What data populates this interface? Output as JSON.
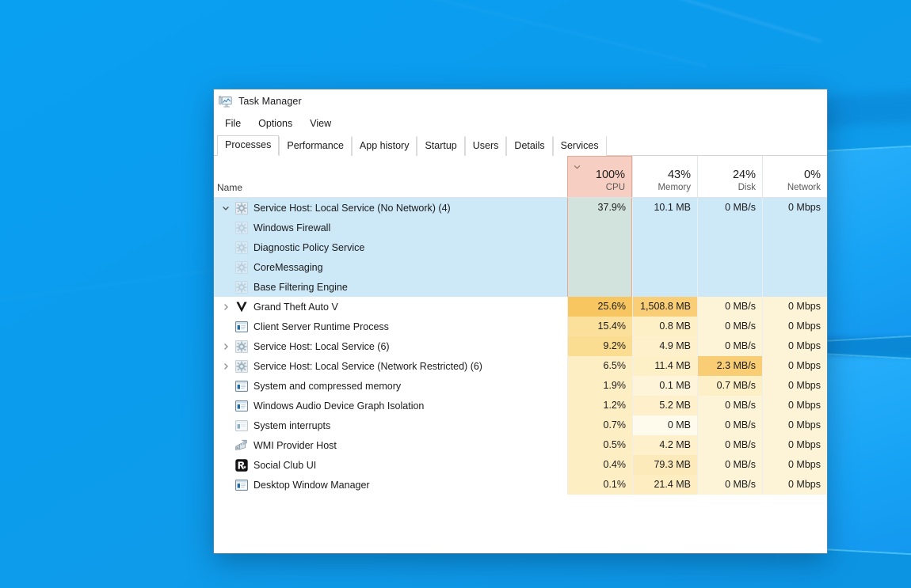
{
  "window": {
    "title": "Task Manager",
    "icon": "task-manager-icon"
  },
  "menu": {
    "items": [
      {
        "label": "File"
      },
      {
        "label": "Options"
      },
      {
        "label": "View"
      }
    ]
  },
  "tabs": {
    "active": "Processes",
    "items": [
      {
        "label": "Processes"
      },
      {
        "label": "Performance"
      },
      {
        "label": "App history"
      },
      {
        "label": "Startup"
      },
      {
        "label": "Users"
      },
      {
        "label": "Details"
      },
      {
        "label": "Services"
      }
    ]
  },
  "columns": {
    "name": {
      "label": "Name"
    },
    "cpu": {
      "value": "100%",
      "label": "CPU",
      "sorted": true,
      "sort_dir": "desc",
      "header_bg": "#f7cfc2",
      "header_border": "#e8a893"
    },
    "memory": {
      "value": "43%",
      "label": "Memory"
    },
    "disk": {
      "value": "24%",
      "label": "Disk"
    },
    "network": {
      "value": "0%",
      "label": "Network"
    }
  },
  "colors": {
    "selection": "#cde8f7",
    "heat_high": "#f7c661",
    "heat_mid": "#fade9c",
    "heat_low": "#fdeec4",
    "heat_faint": "#fef6df",
    "desktop": "#0a9ef0"
  },
  "processes": [
    {
      "name": "Service Host: Local Service (No Network) (4)",
      "icon": "gear-icon",
      "expander": "expanded",
      "selected": true,
      "cpu": "37.9%",
      "memory": "10.1 MB",
      "disk": "0 MB/s",
      "network": "0 Mbps",
      "cpu_bg": "#d2e3dd",
      "mem_bg": "transparent",
      "disk_bg": "transparent",
      "net_bg": "transparent"
    },
    {
      "name": "Windows Firewall",
      "icon": "gear-icon",
      "expander": "none",
      "child": true,
      "selected": true,
      "cpu": "",
      "memory": "",
      "disk": "",
      "network": "",
      "cpu_bg": "#d2e3dd",
      "mem_bg": "transparent",
      "disk_bg": "transparent",
      "net_bg": "transparent"
    },
    {
      "name": "Diagnostic Policy Service",
      "icon": "gear-icon",
      "expander": "none",
      "child": true,
      "selected": true,
      "cpu": "",
      "memory": "",
      "disk": "",
      "network": "",
      "cpu_bg": "#d2e3dd",
      "mem_bg": "transparent",
      "disk_bg": "transparent",
      "net_bg": "transparent"
    },
    {
      "name": "CoreMessaging",
      "icon": "gear-icon",
      "expander": "none",
      "child": true,
      "selected": true,
      "cpu": "",
      "memory": "",
      "disk": "",
      "network": "",
      "cpu_bg": "#d2e3dd",
      "mem_bg": "transparent",
      "disk_bg": "transparent",
      "net_bg": "transparent"
    },
    {
      "name": "Base Filtering Engine",
      "icon": "gear-icon",
      "expander": "none",
      "child": true,
      "selected": true,
      "cpu": "",
      "memory": "",
      "disk": "",
      "network": "",
      "cpu_bg": "#d2e3dd",
      "mem_bg": "transparent",
      "disk_bg": "transparent",
      "net_bg": "transparent"
    },
    {
      "name": "Grand Theft Auto V",
      "icon": "gta-v-icon",
      "expander": "collapsed",
      "cpu": "25.6%",
      "memory": "1,508.8 MB",
      "disk": "0 MB/s",
      "network": "0 Mbps",
      "cpu_bg": "#f7c661",
      "mem_bg": "#f9ce77",
      "disk_bg": "#fdf3d6",
      "net_bg": "#fdf3d6"
    },
    {
      "name": "Client Server Runtime Process",
      "icon": "window-icon",
      "expander": "none",
      "cpu": "15.4%",
      "memory": "0.8 MB",
      "disk": "0 MB/s",
      "network": "0 Mbps",
      "cpu_bg": "#fbe09b",
      "mem_bg": "#fdefc6",
      "disk_bg": "#fdf3d6",
      "net_bg": "#fdf3d6"
    },
    {
      "name": "Service Host: Local Service (6)",
      "icon": "gear-icon",
      "expander": "collapsed",
      "cpu": "9.2%",
      "memory": "4.9 MB",
      "disk": "0 MB/s",
      "network": "0 Mbps",
      "cpu_bg": "#fbdd92",
      "mem_bg": "#fdf0cb",
      "disk_bg": "#fdf3d6",
      "net_bg": "#fdf3d6"
    },
    {
      "name": "Service Host: Local Service (Network Restricted) (6)",
      "icon": "gear-icon",
      "expander": "collapsed",
      "cpu": "6.5%",
      "memory": "11.4 MB",
      "disk": "2.3 MB/s",
      "network": "0 Mbps",
      "cpu_bg": "#fdeec4",
      "mem_bg": "#fdefc6",
      "disk_bg": "#f9cd74",
      "net_bg": "#fdf3d6"
    },
    {
      "name": "System and compressed memory",
      "icon": "window-icon",
      "expander": "none",
      "cpu": "1.9%",
      "memory": "0.1 MB",
      "disk": "0.7 MB/s",
      "network": "0 Mbps",
      "cpu_bg": "#fdeec4",
      "mem_bg": "#fdf4da",
      "disk_bg": "#fdefc6",
      "net_bg": "#fdf3d6"
    },
    {
      "name": "Windows Audio Device Graph Isolation",
      "icon": "window-icon",
      "expander": "none",
      "cpu": "1.2%",
      "memory": "5.2 MB",
      "disk": "0 MB/s",
      "network": "0 Mbps",
      "cpu_bg": "#fdeec4",
      "mem_bg": "#fdf0cb",
      "disk_bg": "#fdf3d6",
      "net_bg": "#fdf3d6"
    },
    {
      "name": "System interrupts",
      "icon": "window-icon-faded",
      "expander": "none",
      "cpu": "0.7%",
      "memory": "0 MB",
      "disk": "0 MB/s",
      "network": "0 Mbps",
      "cpu_bg": "#fdeec4",
      "mem_bg": "#fefaec",
      "disk_bg": "#fdf3d6",
      "net_bg": "#fdf3d6"
    },
    {
      "name": "WMI Provider Host",
      "icon": "wmi-icon",
      "expander": "none",
      "cpu": "0.5%",
      "memory": "4.2 MB",
      "disk": "0 MB/s",
      "network": "0 Mbps",
      "cpu_bg": "#fdeec4",
      "mem_bg": "#fdf0cb",
      "disk_bg": "#fdf3d6",
      "net_bg": "#fdf3d6"
    },
    {
      "name": "Social Club UI",
      "icon": "rockstar-icon",
      "expander": "none",
      "cpu": "0.4%",
      "memory": "79.3 MB",
      "disk": "0 MB/s",
      "network": "0 Mbps",
      "cpu_bg": "#fdeec4",
      "mem_bg": "#fdeabb",
      "disk_bg": "#fdf3d6",
      "net_bg": "#fdf3d6"
    },
    {
      "name": "Desktop Window Manager",
      "icon": "window-icon",
      "expander": "none",
      "cpu": "0.1%",
      "memory": "21.4 MB",
      "disk": "0 MB/s",
      "network": "0 Mbps",
      "cpu_bg": "#fdeec4",
      "mem_bg": "#fdedc1",
      "disk_bg": "#fdf3d6",
      "net_bg": "#fdf3d6"
    }
  ]
}
